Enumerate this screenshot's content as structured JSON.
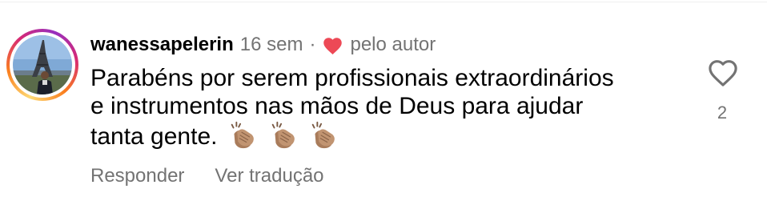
{
  "comment": {
    "username": "wanessapelerin",
    "time_ago": "16 sem",
    "separator": "·",
    "liked_by_author_label": "pelo autor",
    "text_lines": [
      "Parabéns por serem profissionais extraordinários",
      "e instrumentos nas mãos de Deus para ajudar",
      "tanta gente."
    ],
    "emojis": [
      "clapping-hands",
      "clapping-hands",
      "clapping-hands"
    ],
    "like_count": "2",
    "actions": {
      "reply": "Responder",
      "translate": "Ver tradução"
    }
  },
  "colors": {
    "secondary_text": "#737373",
    "author_heart": "#ed4956",
    "primary_text": "#000000"
  },
  "icons": {
    "author_heart": "heart-filled-icon",
    "like": "heart-outline-icon"
  }
}
